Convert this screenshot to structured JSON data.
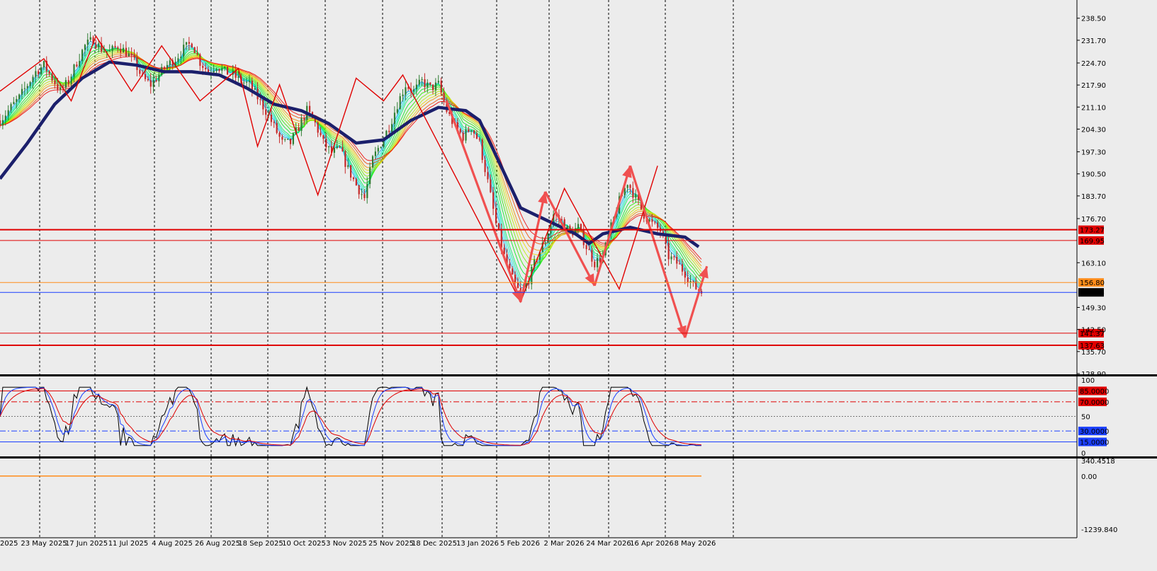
{
  "chart_data": [
    {
      "type": "line",
      "panel": "price",
      "y_ticks": [
        "238.50",
        "231.70",
        "224.70",
        "217.90",
        "211.10",
        "204.30",
        "197.30",
        "190.50",
        "183.70",
        "176.70",
        "163.10",
        "149.30",
        "142.50",
        "135.70",
        "128.90"
      ],
      "ylim": [
        128.9,
        241.5
      ],
      "x_ticks": [
        "2025",
        "23 May 2025",
        "17 Jun 2025",
        "11 Jul 2025",
        "4 Aug 2025",
        "26 Aug 2025",
        "18 Sep 2025",
        "10 Oct 2025",
        "3 Nov 2025",
        "25 Nov 2025",
        "18 Dec 2025",
        "13 Jan 2026",
        "5 Feb 2026",
        "2 Mar 2026",
        "24 Mar 2026",
        "16 Apr 2026",
        "8 May 2026"
      ],
      "price_path": [
        [
          0,
          207
        ],
        [
          4,
          211
        ],
        [
          7,
          214
        ],
        [
          10,
          218
        ],
        [
          13,
          222
        ],
        [
          16,
          224
        ],
        [
          19,
          220
        ],
        [
          22,
          216
        ],
        [
          25,
          219
        ],
        [
          28,
          225
        ],
        [
          31,
          230
        ],
        [
          34,
          232
        ],
        [
          37,
          229
        ],
        [
          40,
          228
        ],
        [
          43,
          230
        ],
        [
          46,
          228
        ],
        [
          49,
          225
        ],
        [
          52,
          220
        ],
        [
          55,
          218
        ],
        [
          58,
          221
        ],
        [
          61,
          224
        ],
        [
          64,
          226
        ],
        [
          67,
          229
        ],
        [
          70,
          231
        ],
        [
          73,
          225
        ],
        [
          76,
          222
        ],
        [
          79,
          224
        ],
        [
          82,
          222
        ],
        [
          85,
          221
        ],
        [
          88,
          219
        ],
        [
          91,
          218
        ],
        [
          94,
          214
        ],
        [
          97,
          210
        ],
        [
          100,
          205
        ],
        [
          103,
          200
        ],
        [
          106,
          200
        ],
        [
          109,
          205
        ],
        [
          112,
          210
        ],
        [
          115,
          206
        ],
        [
          118,
          200
        ],
        [
          121,
          197
        ],
        [
          124,
          198
        ],
        [
          127,
          192
        ],
        [
          130,
          187
        ],
        [
          133,
          183
        ],
        [
          136,
          195
        ],
        [
          139,
          200
        ],
        [
          142,
          205
        ],
        [
          145,
          212
        ],
        [
          148,
          218
        ],
        [
          151,
          216
        ],
        [
          154,
          219
        ],
        [
          157,
          217
        ],
        [
          160,
          218
        ],
        [
          163,
          210
        ],
        [
          166,
          205
        ],
        [
          169,
          202
        ],
        [
          172,
          205
        ],
        [
          175,
          200
        ],
        [
          178,
          188
        ],
        [
          181,
          175
        ],
        [
          184,
          165
        ],
        [
          187,
          158
        ],
        [
          190,
          153
        ],
        [
          193,
          158
        ],
        [
          196,
          165
        ],
        [
          199,
          170
        ],
        [
          202,
          178
        ],
        [
          205,
          176
        ],
        [
          208,
          172
        ],
        [
          211,
          174
        ],
        [
          214,
          168
        ],
        [
          217,
          163
        ],
        [
          220,
          165
        ],
        [
          223,
          174
        ],
        [
          226,
          182
        ],
        [
          229,
          188
        ],
        [
          232,
          183
        ],
        [
          235,
          178
        ],
        [
          238,
          175
        ],
        [
          241,
          173
        ],
        [
          244,
          165
        ],
        [
          247,
          163
        ],
        [
          250,
          160
        ],
        [
          253,
          156
        ],
        [
          256,
          154
        ]
      ],
      "ma_slow": [
        [
          0,
          189
        ],
        [
          10,
          200
        ],
        [
          20,
          212
        ],
        [
          30,
          220
        ],
        [
          40,
          225
        ],
        [
          50,
          224
        ],
        [
          60,
          222
        ],
        [
          70,
          222
        ],
        [
          80,
          221
        ],
        [
          90,
          217
        ],
        [
          100,
          212
        ],
        [
          110,
          210
        ],
        [
          120,
          206
        ],
        [
          130,
          200
        ],
        [
          140,
          201
        ],
        [
          150,
          207
        ],
        [
          160,
          211
        ],
        [
          170,
          210
        ],
        [
          175,
          207
        ],
        [
          180,
          198
        ],
        [
          190,
          180
        ],
        [
          200,
          176
        ],
        [
          210,
          172
        ],
        [
          215,
          169
        ],
        [
          220,
          172
        ],
        [
          230,
          174
        ],
        [
          240,
          172
        ],
        [
          250,
          171
        ],
        [
          255,
          168
        ]
      ],
      "zigzag": [
        [
          0,
          216
        ],
        [
          16,
          226
        ],
        [
          26,
          213
        ],
        [
          35,
          233
        ],
        [
          48,
          216
        ],
        [
          59,
          230
        ],
        [
          73,
          213
        ],
        [
          87,
          223
        ],
        [
          94,
          199
        ],
        [
          102,
          218
        ],
        [
          116,
          184
        ],
        [
          130,
          220
        ],
        [
          140,
          213
        ],
        [
          147,
          221
        ],
        [
          190,
          151
        ],
        [
          206,
          186
        ],
        [
          226,
          155
        ],
        [
          240,
          193
        ]
      ],
      "arrows": [
        {
          "from": [
            163,
            213
          ],
          "to": [
            190,
            151
          ]
        },
        {
          "from": [
            190,
            151
          ],
          "to": [
            199,
            185
          ]
        },
        {
          "from": [
            199,
            185
          ],
          "to": [
            217,
            156
          ]
        },
        {
          "from": [
            217,
            156
          ],
          "to": [
            230,
            193
          ]
        },
        {
          "from": [
            230,
            193
          ],
          "to": [
            250,
            140
          ]
        },
        {
          "from": [
            250,
            140
          ],
          "to": [
            258,
            162
          ]
        }
      ],
      "levels": [
        {
          "value": 173.27,
          "label": "173.27",
          "color": "#e00000"
        },
        {
          "value": 169.95,
          "label": "169.95",
          "color": "#e00000"
        },
        {
          "value": 157.0,
          "label": "156.80",
          "color": "#ff8c1a"
        },
        {
          "value": 153.95,
          "label": "153.95",
          "color": "#1a3fff"
        },
        {
          "value": 141.37,
          "label": "141.37",
          "color": "#e00000"
        },
        {
          "value": 137.63,
          "label": "137.63",
          "color": "#e00000"
        }
      ],
      "current_price": "153.95"
    },
    {
      "type": "line",
      "panel": "oscillator",
      "ylim": [
        0,
        100
      ],
      "y_ticks": [
        "100",
        "50",
        "0"
      ],
      "levels": [
        {
          "value": 85,
          "label": "85.0000",
          "color": "#e00000",
          "dash": "solid"
        },
        {
          "value": 70,
          "label": "70.0000",
          "color": "#e00000",
          "dash": "dashdot"
        },
        {
          "value": 50,
          "label": "",
          "color": "#777777",
          "dash": "dot"
        },
        {
          "value": 30,
          "label": "30.0000",
          "color": "#1a3fff",
          "dash": "dashdot"
        },
        {
          "value": 15,
          "label": "15.0000",
          "color": "#1a3fff",
          "dash": "solid"
        }
      ]
    },
    {
      "type": "line",
      "panel": "bottom",
      "y_ticks": [
        "340.4518",
        "0.00",
        "-1239.840"
      ],
      "ylim": [
        -1239.84,
        340.4518
      ],
      "series": [
        {
          "values": [
            0.0
          ]
        }
      ]
    }
  ],
  "colors": {
    "background": "#ececec",
    "grid": "#000000",
    "bull": "#2e7d32",
    "bear": "#c62828",
    "ma_slow": "#1b1f6b",
    "zigzag": "#e00000",
    "arrow": "#f05050"
  }
}
